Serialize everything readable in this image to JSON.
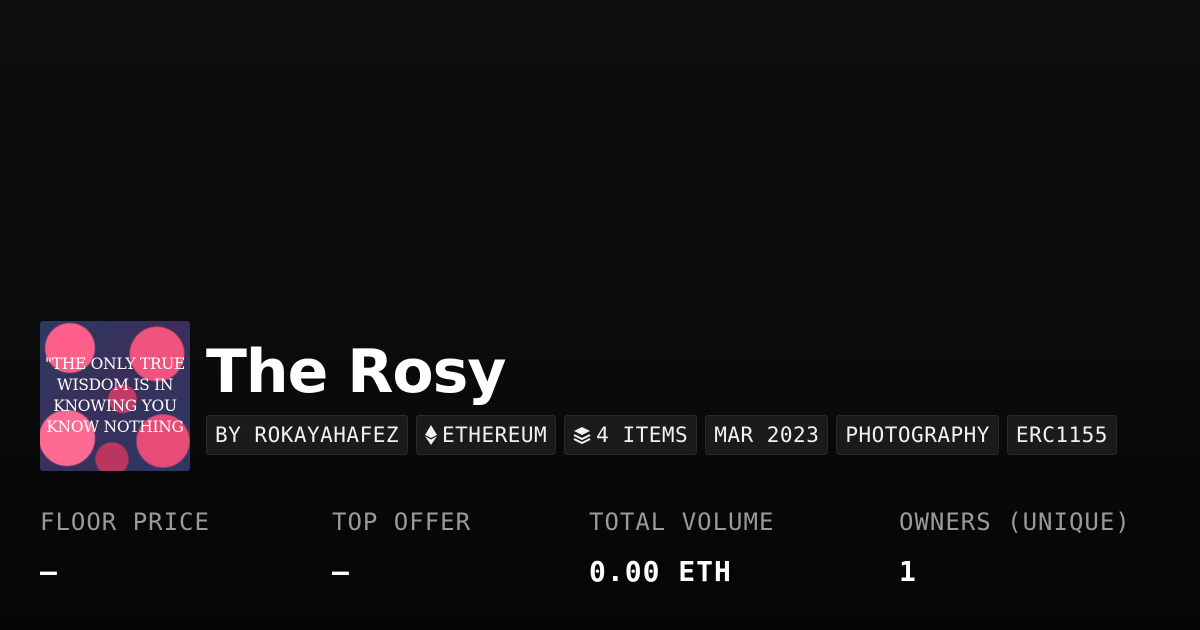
{
  "collection": {
    "title": "The Rosy",
    "thumbnail_quote": "\"THE ONLY TRUE\nWISDOM IS IN\nKNOWING YOU\nKNOW NOTHING"
  },
  "tags": {
    "creator": "BY ROKAYAHAFEZ",
    "chain": "ETHEREUM",
    "chain_icon": "ethereum-icon",
    "items": "4 ITEMS",
    "items_icon": "layers-icon",
    "date": "MAR 2023",
    "category": "PHOTOGRAPHY",
    "standard": "ERC1155"
  },
  "stats": {
    "floor_price": {
      "label": "FLOOR PRICE",
      "value": "–"
    },
    "top_offer": {
      "label": "TOP OFFER",
      "value": "–"
    },
    "total_volume": {
      "label": "TOTAL VOLUME",
      "value": "0.00 ETH"
    },
    "owners": {
      "label": "OWNERS (UNIQUE)",
      "value": "1"
    }
  },
  "colors": {
    "background": "#0b0b0b",
    "tag_background": "#1b1b1b",
    "label_gray": "#9a9a9a",
    "rose_pink": "#f0537d",
    "navy": "#2b3a63"
  }
}
